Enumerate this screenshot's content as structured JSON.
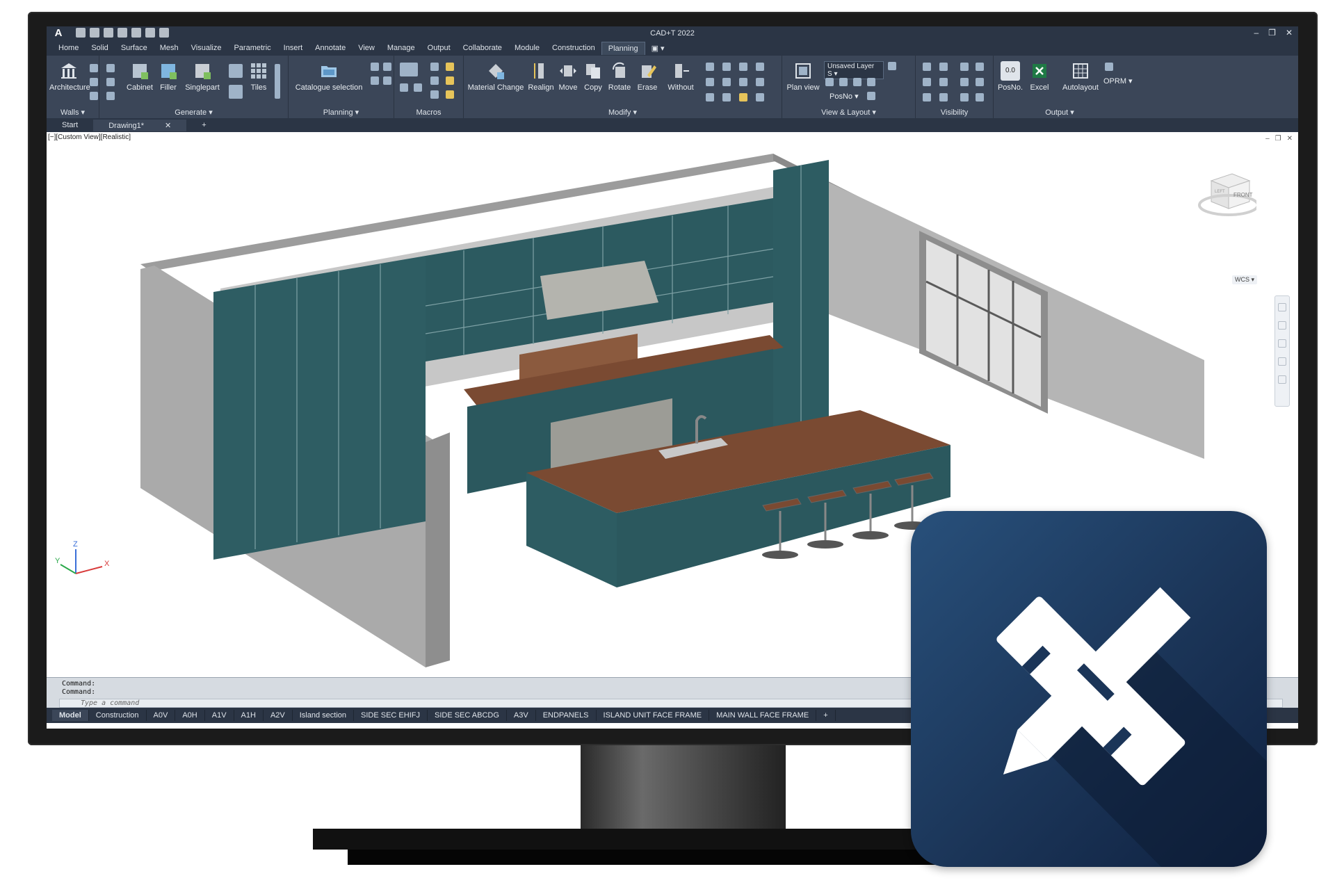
{
  "window": {
    "title": "CAD+T 2022",
    "logo": "A"
  },
  "menu_tabs": [
    "Home",
    "Solid",
    "Surface",
    "Mesh",
    "Visualize",
    "Parametric",
    "Insert",
    "Annotate",
    "View",
    "Manage",
    "Output",
    "Collaborate",
    "Module",
    "Construction",
    "Planning"
  ],
  "active_tab": "Planning",
  "ribbon": {
    "walls": {
      "title": "Walls",
      "tools": [
        "Architecture"
      ]
    },
    "generate": {
      "title": "Generate",
      "tools": [
        "Cabinet",
        "Filler",
        "Singlepart",
        "Tiles"
      ]
    },
    "planning": {
      "title": "Planning",
      "tools": [
        "Catalogue selection"
      ]
    },
    "macros": {
      "title": "Macros"
    },
    "modify": {
      "title": "Modify",
      "tools": [
        "Material Change",
        "Realign",
        "Move",
        "Copy",
        "Rotate",
        "Erase",
        "Without"
      ]
    },
    "view_layout": {
      "title": "View & Layout",
      "tools": [
        "Plan view"
      ],
      "layer_select": "Unsaved Layer S",
      "posno": "PosNo"
    },
    "visibility": {
      "title": "Visibility"
    },
    "output": {
      "title": "Output",
      "tools": [
        "PosNo.",
        "Excel",
        "Autolayout"
      ],
      "posno_value": "0.0",
      "oprm": "OPRM"
    }
  },
  "file_tabs": [
    "Start",
    "Drawing1*"
  ],
  "viewport": {
    "label": "[−][Custom View][Realistic]",
    "wcs": "WCS",
    "viewcube_face": "FRONT",
    "viewcube_side": "LEFT"
  },
  "command": {
    "line1": "Command:",
    "line2": "Command:",
    "placeholder": "Type a command"
  },
  "layout_tabs": [
    "Model",
    "Construction",
    "A0V",
    "A0H",
    "A1V",
    "A1H",
    "A2V",
    "Island section",
    "SIDE SEC EHIFJ",
    "SIDE SEC ABCDG",
    "A3V",
    "ENDPANELS",
    "ISLAND UNIT FACE FRAME",
    "MAIN WALL FACE FRAME"
  ],
  "active_layout": "Model",
  "colors": {
    "ribbon": "#3b4658",
    "chrome": "#2b3545",
    "cabinet": "#2e5d63",
    "worktop": "#7a4a32",
    "wall": "#a9a9a9",
    "icon_top": "#28507b",
    "icon_bottom": "#0f2140"
  }
}
